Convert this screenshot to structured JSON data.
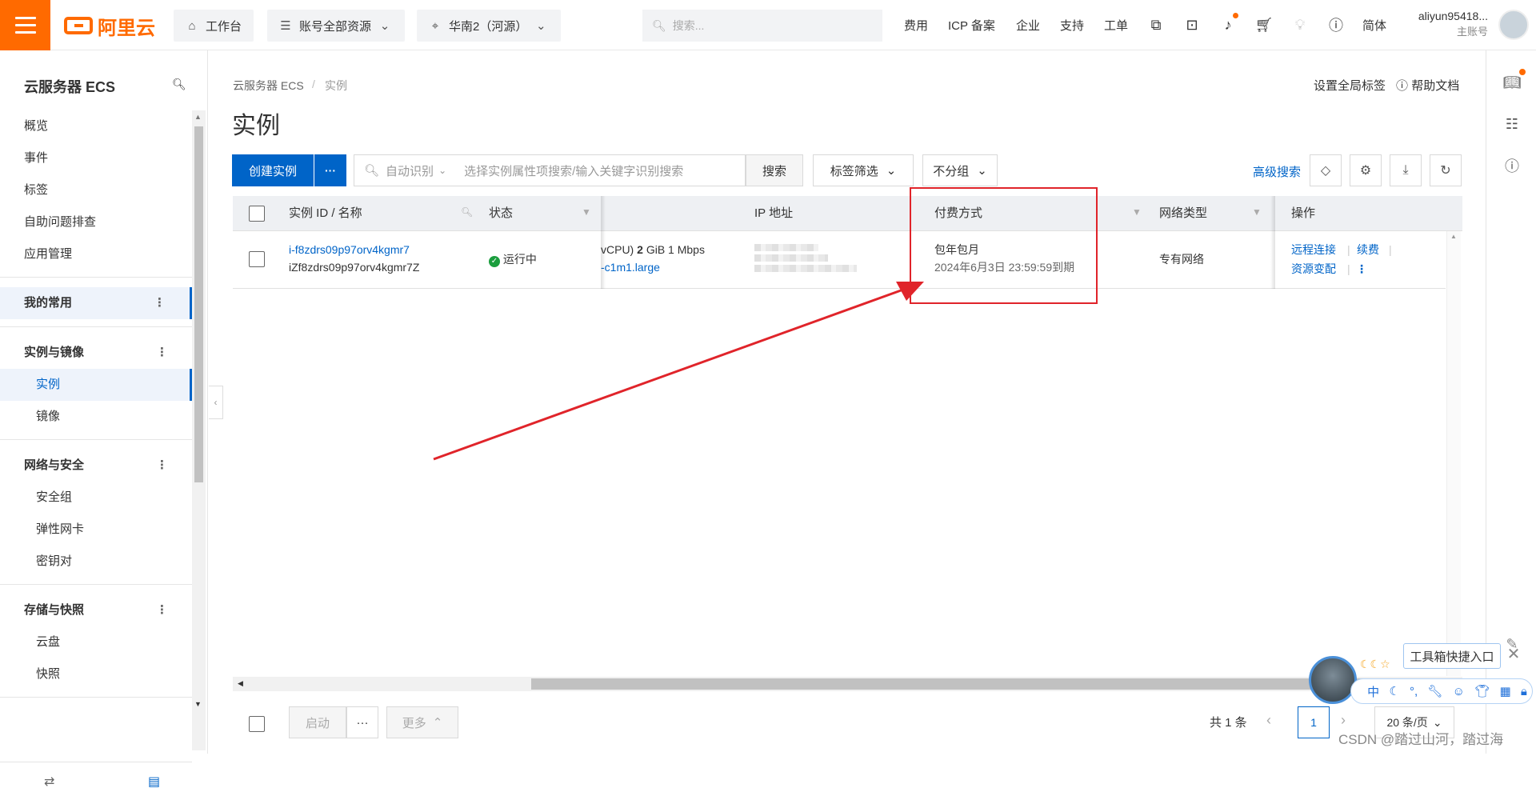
{
  "topbar": {
    "logo_text": "阿里云",
    "workbench": "工作台",
    "resources": "账号全部资源",
    "region": "华南2（河源）",
    "search_placeholder": "搜索...",
    "nav": [
      "费用",
      "ICP 备案",
      "企业",
      "支持",
      "工单"
    ],
    "lang": "简体",
    "user_name": "aliyun95418...",
    "user_role": "主账号"
  },
  "sidebar": {
    "title": "云服务器 ECS",
    "items_top": [
      "概览",
      "事件",
      "标签",
      "自助问题排查",
      "应用管理"
    ],
    "fav_group": "我的常用",
    "group_instances": "实例与镜像",
    "instances": "实例",
    "images": "镜像",
    "group_network": "网络与安全",
    "security_group": "安全组",
    "eni": "弹性网卡",
    "keypair": "密钥对",
    "group_storage": "存储与快照",
    "disk": "云盘",
    "snapshot": "快照"
  },
  "breadcrumb": {
    "root": "云服务器 ECS",
    "sep": "/",
    "current": "实例"
  },
  "header_links": {
    "global_tags": "设置全局标签",
    "help": "帮助文档"
  },
  "page_title": "实例",
  "toolbar": {
    "create": "创建实例",
    "more": "···",
    "auto_detect": "自动识别",
    "filter_placeholder": "选择实例属性项搜索/输入关键字识别搜索",
    "search": "搜索",
    "tag_filter": "标签筛选",
    "group": "不分组",
    "advanced": "高级搜索"
  },
  "table": {
    "columns": [
      "实例 ID / 名称",
      "状态",
      "IP 地址",
      "付费方式",
      "网络类型",
      "操作"
    ],
    "row": {
      "id": "i-f8zdrs09p97orv4kgmr7",
      "name": "iZf8zdrs09p97orv4kgmr7Z",
      "status": "运行中",
      "spec_line1_a": "vCPU)",
      "spec_line1_b": "2",
      "spec_line1_c": "GiB 1 Mbps",
      "spec_line2": "-c1m1.large",
      "billing": "包年包月",
      "expire": "2024年6月3日 23:59:59到期",
      "network": "专有网络",
      "action_remote": "远程连接",
      "action_renew": "续费",
      "action_change": "资源变配",
      "sep": "|"
    }
  },
  "footer": {
    "start": "启动",
    "more_btn": "···",
    "more": "更多",
    "total": "共 1 条",
    "page": "1",
    "page_size": "20 条/页"
  },
  "overlay": {
    "toolbox": "工具箱快捷入口",
    "ime_lang": "中",
    "watermark": "CSDN @踏过山河，踏过海"
  }
}
